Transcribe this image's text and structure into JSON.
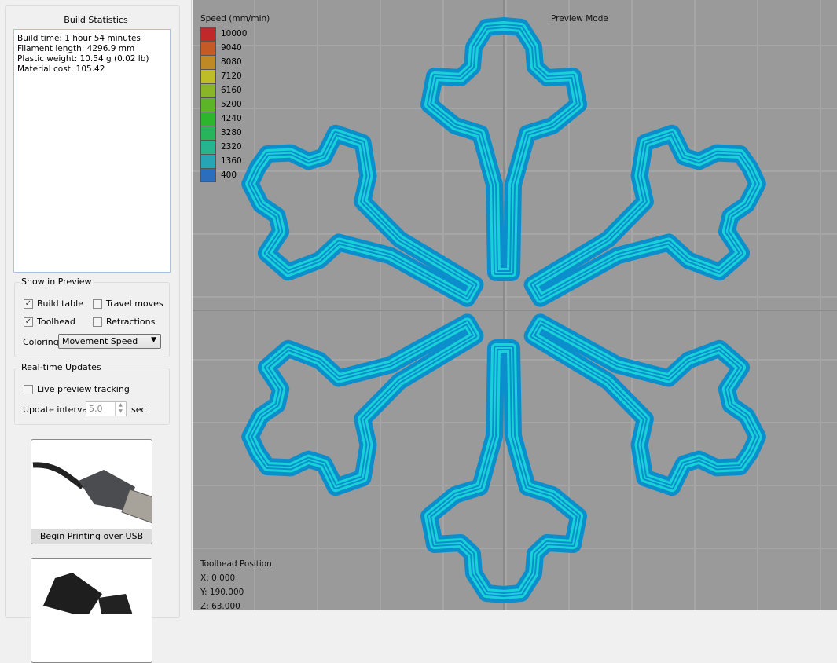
{
  "sidebar": {
    "build_statistics": {
      "title": "Build Statistics",
      "lines": [
        "Build time: 1 hour 54 minutes",
        "Filament length: 4296.9 mm",
        "Plastic weight: 10.54 g (0.02 lb)",
        "Material cost: 105.42"
      ]
    },
    "show_in_preview": {
      "title": "Show in Preview",
      "build_table": "Build table",
      "build_table_checked": true,
      "travel_moves": "Travel moves",
      "travel_moves_checked": false,
      "toolhead": "Toolhead",
      "toolhead_checked": true,
      "retractions": "Retractions",
      "retractions_checked": false,
      "coloring_label": "Coloring",
      "coloring_value": "Movement Speed"
    },
    "realtime": {
      "title": "Real-time Updates",
      "live_tracking": "Live preview tracking",
      "live_tracking_checked": false,
      "interval_label": "Update interval",
      "interval_value": "5,0",
      "interval_unit": "sec"
    },
    "usb_button": "Begin Printing over USB"
  },
  "viewport": {
    "mode": "Preview Mode",
    "legend_title": "Speed (mm/min)",
    "legend": [
      {
        "label": "10000",
        "color": "#c0282a"
      },
      {
        "label": "9040",
        "color": "#c45a26"
      },
      {
        "label": "8080",
        "color": "#bf8a26"
      },
      {
        "label": "7120",
        "color": "#bdbd26"
      },
      {
        "label": "6160",
        "color": "#8ab526"
      },
      {
        "label": "5200",
        "color": "#5cb526"
      },
      {
        "label": "4240",
        "color": "#2db52d"
      },
      {
        "label": "3280",
        "color": "#26b55a"
      },
      {
        "label": "2320",
        "color": "#26b58e"
      },
      {
        "label": "1360",
        "color": "#26a6b5"
      },
      {
        "label": "400",
        "color": "#2a6fbf"
      }
    ],
    "toolhead_title": "Toolhead Position",
    "x": "X: 0.000",
    "y": "Y: 190.000",
    "z": "Z: 63.000",
    "colors": {
      "outer": "#0b8fcc",
      "inner": "#19d2d8"
    }
  }
}
